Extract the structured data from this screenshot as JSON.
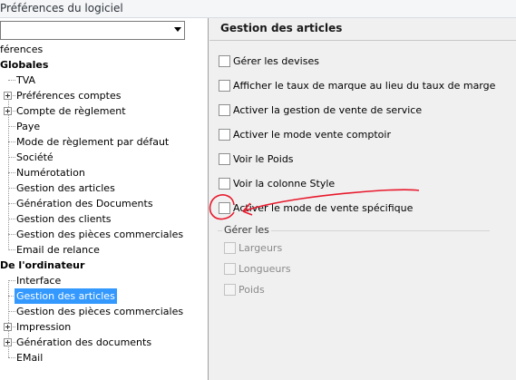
{
  "window": {
    "title": "Préférences du logiciel"
  },
  "combo": {
    "value": ""
  },
  "tree": {
    "root": "férences",
    "globales": {
      "label": "Globales",
      "items": [
        "TVA",
        "Préférences comptes",
        "Compte de règlement",
        "Paye",
        "Mode de règlement par défaut",
        "Société",
        "Numérotation",
        "Gestion des articles",
        "Génération des Documents",
        "Gestion des clients",
        "Gestion des pièces commerciales",
        "Email de relance"
      ]
    },
    "ordinateur": {
      "label": "De l'ordinateur",
      "items": [
        "Interface",
        "Gestion des articles",
        "Gestion des pièces commerciales",
        "Impression",
        "Génération des documents",
        "EMail"
      ]
    }
  },
  "panel": {
    "title": "Gestion des articles",
    "options": [
      {
        "label": "Gérer les devises",
        "checked": false
      },
      {
        "label": "Afficher le taux de marque au lieu du taux de marge",
        "checked": false
      },
      {
        "label": "Activer la gestion de vente de service",
        "checked": false
      },
      {
        "label": "Activer le mode vente comptoir",
        "checked": false
      },
      {
        "label": "Voir le Poids",
        "checked": false
      },
      {
        "label": "Voir la colonne Style",
        "checked": false
      },
      {
        "label": "Activer le mode de vente spécifique",
        "checked": false
      }
    ],
    "group": {
      "legend": "Gérer les",
      "options": [
        {
          "label": "Largeurs",
          "checked": false,
          "enabled": false
        },
        {
          "label": "Longueurs",
          "checked": false,
          "enabled": false
        },
        {
          "label": "Poids",
          "checked": false,
          "enabled": false
        }
      ]
    }
  },
  "annotation_color": "#e8192c"
}
